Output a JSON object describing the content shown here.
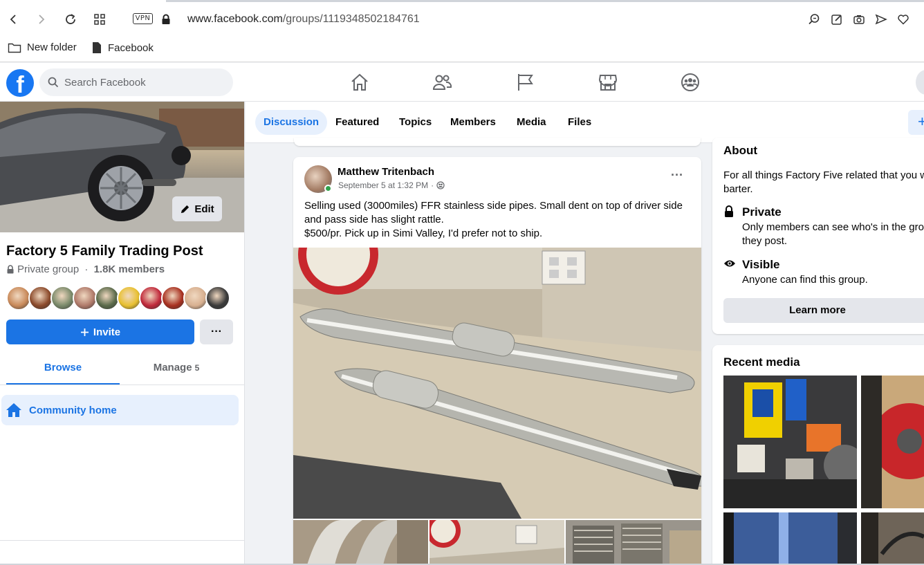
{
  "browser": {
    "url_host": "www.facebook.com",
    "url_path": "/groups/1119348502184761",
    "vpn_label": "VPN",
    "bookmarks": [
      {
        "label": "New folder",
        "icon": "folder-icon"
      },
      {
        "label": "Facebook",
        "icon": "file-icon"
      }
    ]
  },
  "header": {
    "logo": "f",
    "search_placeholder": "Search Facebook",
    "nav_icons": [
      "home-icon",
      "friends-icon",
      "pages-flag-icon",
      "marketplace-icon",
      "groups-icon"
    ]
  },
  "group": {
    "name": "Factory 5 Family Trading Post",
    "privacy": "Private group",
    "separator": " · ",
    "members": "1.8K members",
    "edit_label": "Edit",
    "invite_label": "Invite",
    "more_label": "···",
    "tabs": {
      "browse": "Browse",
      "manage": "Manage",
      "manage_count": "5"
    },
    "community_home": "Community home",
    "member_avatar_colors": [
      "#c98a5a",
      "#8b4a2b",
      "#7a8a6a",
      "#b07a6a",
      "#5a6a4a",
      "#e8c030",
      "#c0283a",
      "#a83020",
      "#d8b090",
      "#3a3a3a"
    ]
  },
  "group_tabs": [
    "Discussion",
    "Featured",
    "Topics",
    "Members",
    "Media",
    "Files"
  ],
  "group_tabs_plus": "+",
  "post": {
    "author": "Matthew Tritenbach",
    "time": "September 5 at 1:32 PM",
    "time_sep": "·",
    "more": "···",
    "text_line1": "Selling used (3000miles) FFR stainless side pipes. Small dent on top of driver side",
    "text_line2": "and pass side has slight rattle.",
    "text_line3": "$500/pr. Pick up in Simi Valley, I'd prefer not to ship."
  },
  "about": {
    "title": "About",
    "desc_line1": "For all things Factory Five related that you w",
    "desc_line2": "barter.",
    "private_title": "Private",
    "private_desc_line1": "Only members can see who's in the grou",
    "private_desc_line2": "they post.",
    "visible_title": "Visible",
    "visible_desc": "Anyone can find this group.",
    "learn_more": "Learn more"
  },
  "recent_media": {
    "title": "Recent media"
  },
  "colors": {
    "brand_blue": "#1877f2",
    "accent_blue": "#1b74e4",
    "active_bg": "#e7f0fd",
    "page_bg": "#f0f2f5"
  }
}
